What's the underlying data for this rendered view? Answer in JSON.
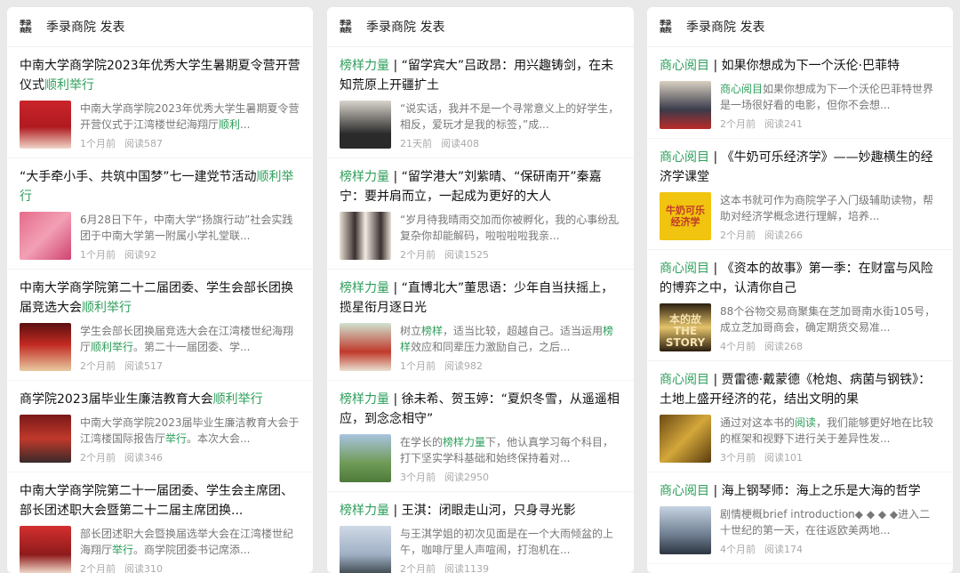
{
  "columns": [
    {
      "header": {
        "logo": [
          "季录",
          "商院"
        ],
        "title": "季录商院 发表"
      },
      "articles": [
        {
          "title_parts": [
            {
              "text": "中南大学商学院2023年优秀大学生暑期夏令营开营仪式"
            },
            {
              "text": "顺利举行",
              "hl": true
            }
          ],
          "summary_parts": [
            {
              "text": "中南大学商学院2023年优秀大学生暑期夏令营开营仪式于江湾楼世纪海翔厅"
            },
            {
              "text": "顺利",
              "hl": true
            },
            {
              "text": "..."
            }
          ],
          "time": "1个月前",
          "reads": "阅读587",
          "thumb": "red-podium"
        },
        {
          "title_parts": [
            {
              "text": "“大手牵小手、共筑中国梦”七一建党节活动"
            },
            {
              "text": "顺利举行",
              "hl": true
            }
          ],
          "summary_parts": [
            {
              "text": "6月28日下午，中南大学“扬旗行动”社会实践团于中南大学第一附属小学礼堂联..."
            }
          ],
          "time": "1个月前",
          "reads": "阅读92",
          "thumb": "pink-group"
        },
        {
          "title_parts": [
            {
              "text": "中南大学商学院第二十二届团委、学生会部长团换届竞选大会"
            },
            {
              "text": "顺利举行",
              "hl": true
            }
          ],
          "summary_parts": [
            {
              "text": "学生会部长团换届竞选大会在江湾楼世纪海翔厅"
            },
            {
              "text": "顺利举行",
              "hl": true
            },
            {
              "text": "。第二十一届团委、学..."
            }
          ],
          "time": "2个月前",
          "reads": "阅读517",
          "thumb": "stage"
        },
        {
          "title_parts": [
            {
              "text": "商学院2023届毕业生廉洁教育大会"
            },
            {
              "text": "顺利举行",
              "hl": true
            }
          ],
          "summary_parts": [
            {
              "text": "中南大学商学院2023届毕业生廉洁教育大会于江湾楼国际报告厅"
            },
            {
              "text": "举行",
              "hl": true
            },
            {
              "text": "。本次大会..."
            }
          ],
          "time": "2个月前",
          "reads": "阅读346",
          "thumb": "hall"
        },
        {
          "title_parts": [
            {
              "text": "中南大学商学院第二十一届团委、学生会主席团、部长团述职大会暨第二十二届主席团换..."
            }
          ],
          "summary_parts": [
            {
              "text": "部长团述职大会暨换届选举大会在江湾楼世纪海翔厅"
            },
            {
              "text": "举行",
              "hl": true
            },
            {
              "text": "。商学院团委书记席添..."
            }
          ],
          "time": "2个月前",
          "reads": "阅读310",
          "thumb": "banner"
        }
      ]
    },
    {
      "header": {
        "logo": [
          "季录",
          "商院"
        ],
        "title": "季录商院 发表"
      },
      "articles": [
        {
          "title_parts": [
            {
              "text": "榜样力量",
              "hl": true
            },
            {
              "text": " | “留学宾大”吕政昂：用兴趣铸剑，在未知荒原上开疆扩土"
            }
          ],
          "summary_parts": [
            {
              "text": "“说实话，我并不是一个寻常意义上的好学生，相反，爱玩才是我的标签，”成..."
            }
          ],
          "time": "21天前",
          "reads": "阅读408",
          "thumb": "portrait"
        },
        {
          "title_parts": [
            {
              "text": "榜样力量",
              "hl": true
            },
            {
              "text": " | “留学港大”刘紫晴、“保研南开”秦嘉宁：要并肩而立，一起成为更好的大人"
            }
          ],
          "summary_parts": [
            {
              "text": "“岁月待我晴雨交加而你被孵化，我的心事纷乱复杂你却能解码，啦啦啦啦我亲..."
            }
          ],
          "time": "2个月前",
          "reads": "阅读1525",
          "thumb": "two-portraits"
        },
        {
          "title_parts": [
            {
              "text": "榜样力量",
              "hl": true
            },
            {
              "text": " | “直博北大”董思语：少年自当扶摇上，揽星衔月逐日光"
            }
          ],
          "summary_parts": [
            {
              "text": "树立"
            },
            {
              "text": "榜样",
              "hl": true
            },
            {
              "text": "，适当比较，超越自己。适当运用"
            },
            {
              "text": "榜样",
              "hl": true
            },
            {
              "text": "效应和同辈压力激励自己，之后..."
            }
          ],
          "time": "1个月前",
          "reads": "阅读982",
          "thumb": "dog"
        },
        {
          "title_parts": [
            {
              "text": "榜样力量",
              "hl": true
            },
            {
              "text": " | 徐未希、贺玉婷：“夏炽冬雪，从遥遥相应，到念念相守”"
            }
          ],
          "summary_parts": [
            {
              "text": "在学长的"
            },
            {
              "text": "榜样力量",
              "hl": true
            },
            {
              "text": "下，他认真学习每个科目，打下坚实学科基础和始终保持着对..."
            }
          ],
          "time": "3个月前",
          "reads": "阅读2950",
          "thumb": "field"
        },
        {
          "title_parts": [
            {
              "text": "榜样力量",
              "hl": true
            },
            {
              "text": " | 王淇：闭眼走山河，只身寻光影"
            }
          ],
          "summary_parts": [
            {
              "text": "与王淇学姐的初次见面是在一个大雨倾盆的上午，咖啡厅里人声喧闹，打泡机在..."
            }
          ],
          "time": "2个月前",
          "reads": "阅读1139",
          "thumb": "sky"
        }
      ]
    },
    {
      "header": {
        "logo": [
          "季录",
          "商院"
        ],
        "title": "季录商院 发表"
      },
      "articles": [
        {
          "title_parts": [
            {
              "text": "商心阅目",
              "hl": true
            },
            {
              "text": " | 如果你想成为下一个沃伦·巴菲特"
            }
          ],
          "summary_parts": [
            {
              "text": "商心阅目",
              "hl": true
            },
            {
              "text": "如果你想成为下一个沃伦巴菲特世界是一场很好看的电影，但你不会想..."
            }
          ],
          "time": "2个月前",
          "reads": "阅读241",
          "thumb": "buffett"
        },
        {
          "title_parts": [
            {
              "text": "商心阅目",
              "hl": true
            },
            {
              "text": " | 《牛奶可乐经济学》——妙趣横生的经济学课堂"
            }
          ],
          "summary_parts": [
            {
              "text": "这本书就可作为商院学子入门级辅助读物，帮助对经济学概念进行理解，培养..."
            }
          ],
          "time": "2个月前",
          "reads": "阅读266",
          "thumb": "milk-book"
        },
        {
          "title_parts": [
            {
              "text": "商心阅目",
              "hl": true
            },
            {
              "text": " | 《资本的故事》第一季：在财富与风险的博弈之中，认清你自己"
            }
          ],
          "summary_parts": [
            {
              "text": "88个谷物交易商聚集在芝加哥南水街105号，成立芝加哥商会，确定期货交易准..."
            }
          ],
          "time": "4个月前",
          "reads": "阅读268",
          "thumb": "capital-book"
        },
        {
          "title_parts": [
            {
              "text": "商心阅目",
              "hl": true
            },
            {
              "text": " | 贾雷德·戴蒙德《枪炮、病菌与钢铁》：土地上盛开经济的花，结出文明的果"
            }
          ],
          "summary_parts": [
            {
              "text": "通过对这本书的"
            },
            {
              "text": "阅读",
              "hl": true
            },
            {
              "text": "，我们能够更好地在比较的框架和视野下进行关于差异性发..."
            }
          ],
          "time": "3个月前",
          "reads": "阅读101",
          "thumb": "gold"
        },
        {
          "title_parts": [
            {
              "text": "商心阅目",
              "hl": true
            },
            {
              "text": " | 海上钢琴师：海上之乐是大海的哲学"
            }
          ],
          "summary_parts": [
            {
              "text": "剧情梗概brief introduction◆ ◆ ◆ ◆进入二十世纪的第一天，在往返欧美两地..."
            }
          ],
          "time": "4个月前",
          "reads": "阅读174",
          "thumb": "steel"
        }
      ]
    }
  ],
  "thumb_text": {
    "milk-book": "牛奶可乐\n经济学",
    "capital-book": "本的故\nTHE STORY"
  },
  "colors": {
    "accent": "#2e9e5b",
    "background": "#e9e9e9",
    "card": "#ffffff"
  }
}
